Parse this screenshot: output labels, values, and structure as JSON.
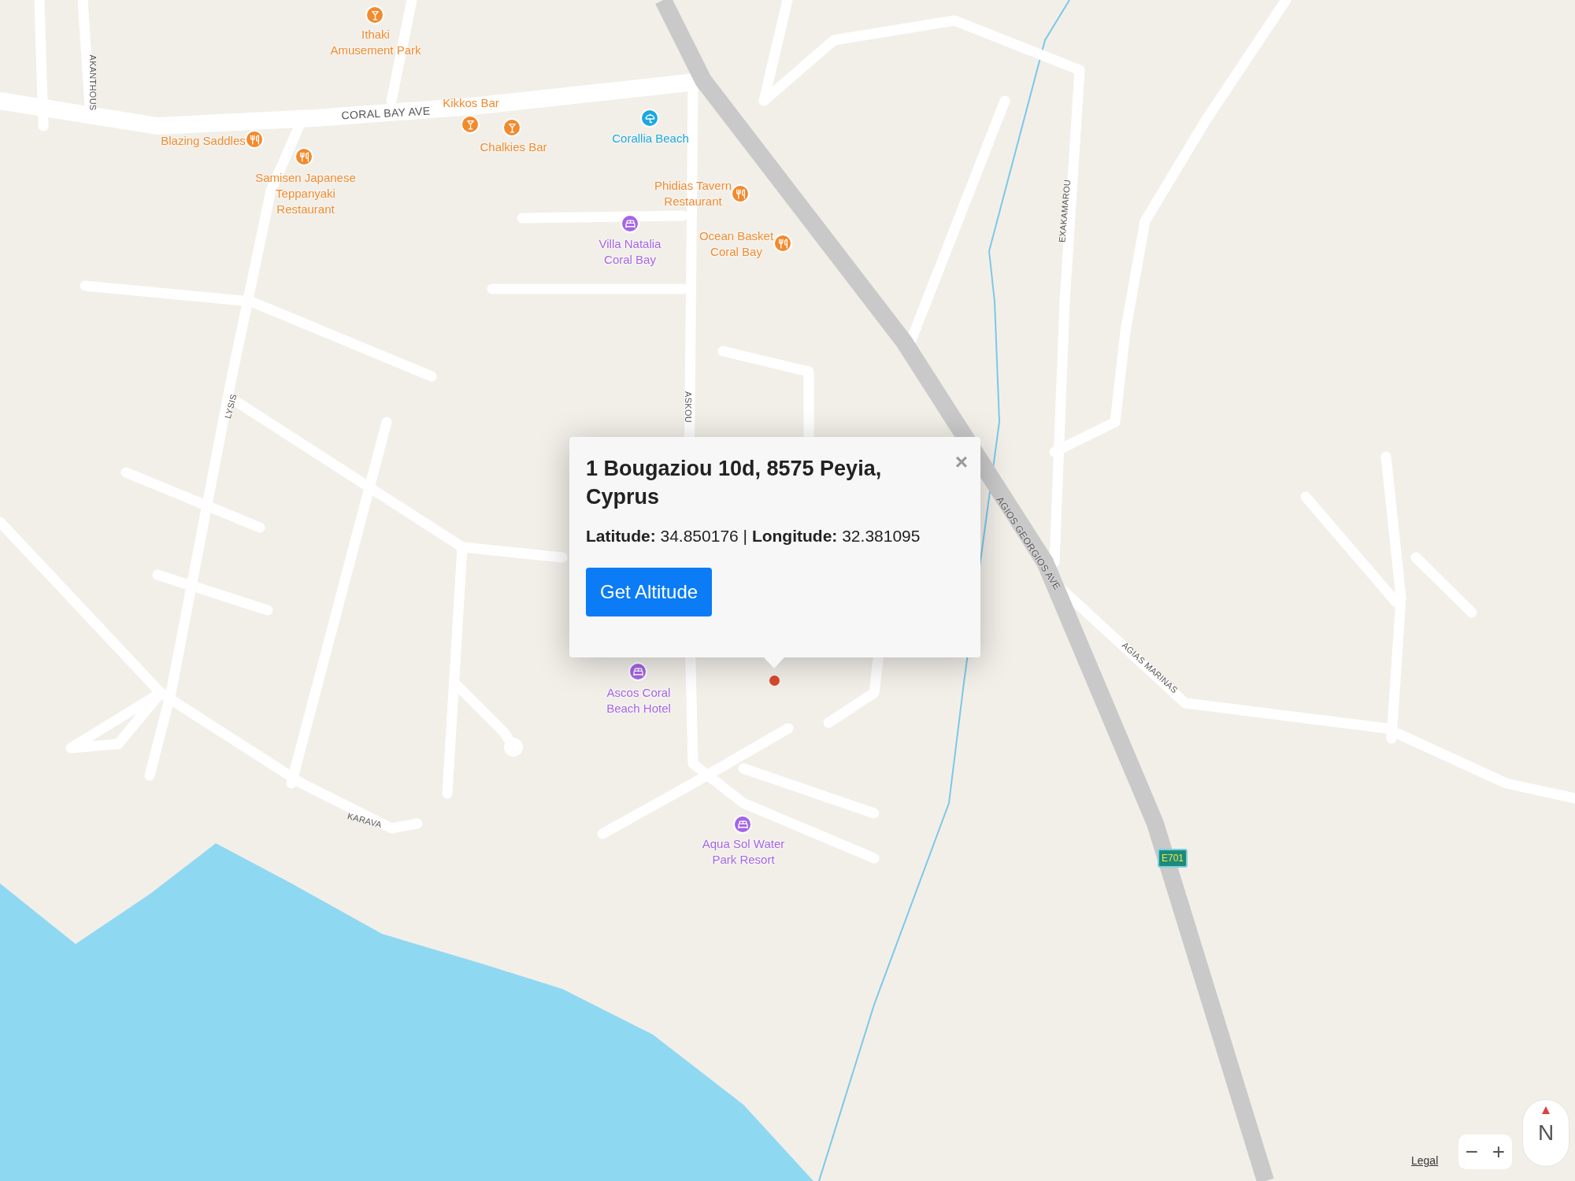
{
  "map": {
    "pois": [
      {
        "kind": "bar",
        "color": "#f28a2e",
        "lines": [
          "Ithaki",
          "Amusement Park"
        ]
      },
      {
        "kind": "bar",
        "color": "#f28a2e",
        "lines": [
          "Kikkos Bar"
        ]
      },
      {
        "kind": "bar",
        "color": "#f28a2e",
        "lines": [
          "Chalkies Bar"
        ]
      },
      {
        "kind": "restaurant",
        "color": "#f28a2e",
        "lines": [
          "Blazing Saddles"
        ]
      },
      {
        "kind": "restaurant",
        "color": "#f28a2e",
        "lines": [
          "Samisen Japanese",
          "Teppanyaki",
          "Restaurant"
        ]
      },
      {
        "kind": "beach",
        "color": "#1ba8dc",
        "lines": [
          "Corallia Beach"
        ]
      },
      {
        "kind": "restaurant",
        "color": "#f28a2e",
        "lines": [
          "Phidias Tavern",
          "Restaurant"
        ]
      },
      {
        "kind": "hotel",
        "color": "#a565e6",
        "lines": [
          "Villa Natalia",
          "Coral Bay"
        ]
      },
      {
        "kind": "restaurant",
        "color": "#f28a2e",
        "lines": [
          "Ocean Basket",
          "Coral Bay"
        ]
      },
      {
        "kind": "hotel",
        "color": "#a565e6",
        "lines": [
          "Ascos Coral",
          "Beach Hotel"
        ]
      },
      {
        "kind": "hotel",
        "color": "#a565e6",
        "lines": [
          "Aqua Sol Water",
          "Park Resort"
        ]
      }
    ],
    "streets": [
      "CORAL BAY AVE",
      "AKANTHOUS",
      "LYSIS",
      "ASKOU",
      "AGIOS GEORGIOS AVE",
      "EXAKAMAROU",
      "AGIAS MARINAS",
      "KARAVA"
    ],
    "route_shield": "E701",
    "legal_link": "Legal",
    "zoom_out": "−",
    "zoom_in": "+",
    "compass": "N"
  },
  "popup": {
    "title": "1 Bougaziou 10d, 8575 Peyia, Cyprus",
    "coordinates": "**Latitude:** 34.850176 | **Longitude:** 32.381095",
    "button": "Get Altitude",
    "close": "×"
  }
}
